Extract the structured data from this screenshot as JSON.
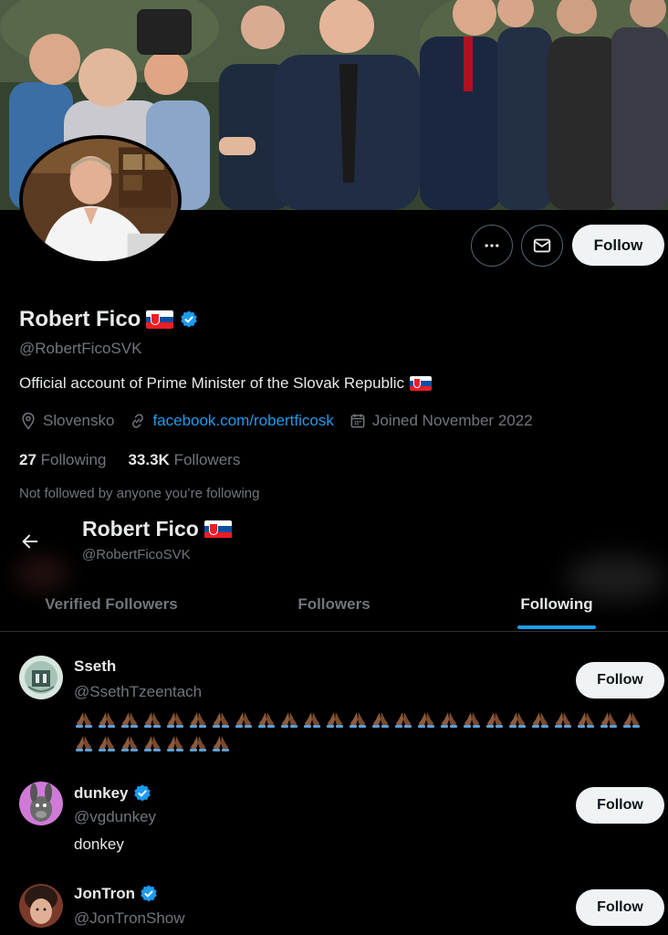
{
  "profile": {
    "name": "Robert Fico",
    "handle": "@RobertFicoSVK",
    "bio": "Official account of Prime Minister of the Slovak Republic",
    "location": "Slovensko",
    "website": "facebook.com/robertficosk",
    "joined": "Joined November 2022",
    "following_count": "27",
    "following_label": "Following",
    "followers_count": "33.3K",
    "followers_label": "Followers",
    "not_followed": "Not followed by anyone you’re following",
    "follow_label": "Follow"
  },
  "sticky_header": {
    "name": "Robert Fico",
    "handle": "@RobertFicoSVK"
  },
  "tabs": [
    {
      "label": "Verified Followers",
      "active": false
    },
    {
      "label": "Followers",
      "active": false
    },
    {
      "label": "Following",
      "active": true
    }
  ],
  "following_list": [
    {
      "name": "Sseth",
      "handle": "@SsethTzeentach",
      "verified": false,
      "bio_emoji_count": 32,
      "bio_emoji": "folded-hands-medium-dark-skin",
      "follow_label": "Follow"
    },
    {
      "name": "dunkey",
      "handle": "@vgdunkey",
      "verified": true,
      "bio": "donkey",
      "follow_label": "Follow"
    },
    {
      "name": "JonTron",
      "handle": "@JonTronShow",
      "verified": true,
      "follow_label": "Follow"
    }
  ],
  "colors": {
    "accent": "#1d9bf0",
    "background": "#000000",
    "text_primary": "#e7e9ea",
    "text_secondary": "#71767b",
    "button_light": "#eff3f4"
  },
  "icons": {
    "more": "more-dots-icon",
    "message": "envelope-icon",
    "location": "location-pin-icon",
    "link": "link-icon",
    "calendar": "calendar-icon",
    "back": "back-arrow-icon",
    "verified": "verified-badge-icon"
  }
}
